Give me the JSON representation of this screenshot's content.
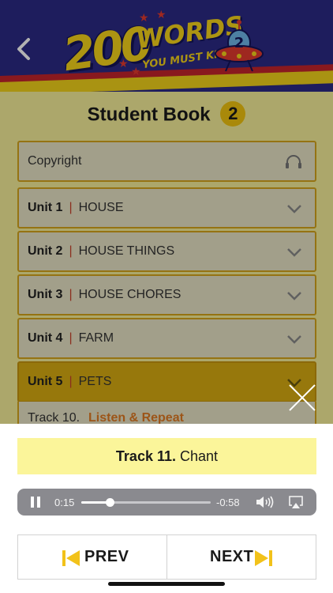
{
  "header": {
    "logo_number": "200",
    "logo_words": "WORDS",
    "logo_tagline": "YOU MUST KNOW!",
    "logo_badge_number": "2",
    "colors": {
      "navy": "#2b2a86",
      "yellow": "#f7d41a",
      "red": "#c4252c"
    }
  },
  "book": {
    "title": "Student Book",
    "number": "2"
  },
  "list": {
    "copyright_label": "Copyright",
    "units": [
      {
        "unit": "Unit 1",
        "name": "HOUSE",
        "state": "collapsed"
      },
      {
        "unit": "Unit 2",
        "name": "HOUSE THINGS",
        "state": "collapsed"
      },
      {
        "unit": "Unit 3",
        "name": "HOUSE CHORES",
        "state": "collapsed"
      },
      {
        "unit": "Unit 4",
        "name": "FARM",
        "state": "collapsed"
      },
      {
        "unit": "Unit 5",
        "name": "PETS",
        "state": "expanded"
      }
    ],
    "partial_track": {
      "label": "Track 10.",
      "name": "Listen & Repeat"
    }
  },
  "player": {
    "track_label": "Track 11.",
    "track_name": "Chant",
    "time_current": "0:15",
    "time_remaining": "-0:58",
    "progress": 0.22
  },
  "nav": {
    "prev_label": "PREV",
    "next_label": "NEXT"
  },
  "icons": [
    "back-arrow-icon",
    "headphones-icon",
    "chevron-down-icon",
    "close-icon",
    "pause-icon",
    "volume-icon",
    "airplay-icon",
    "skip-previous-icon",
    "skip-next-icon"
  ]
}
